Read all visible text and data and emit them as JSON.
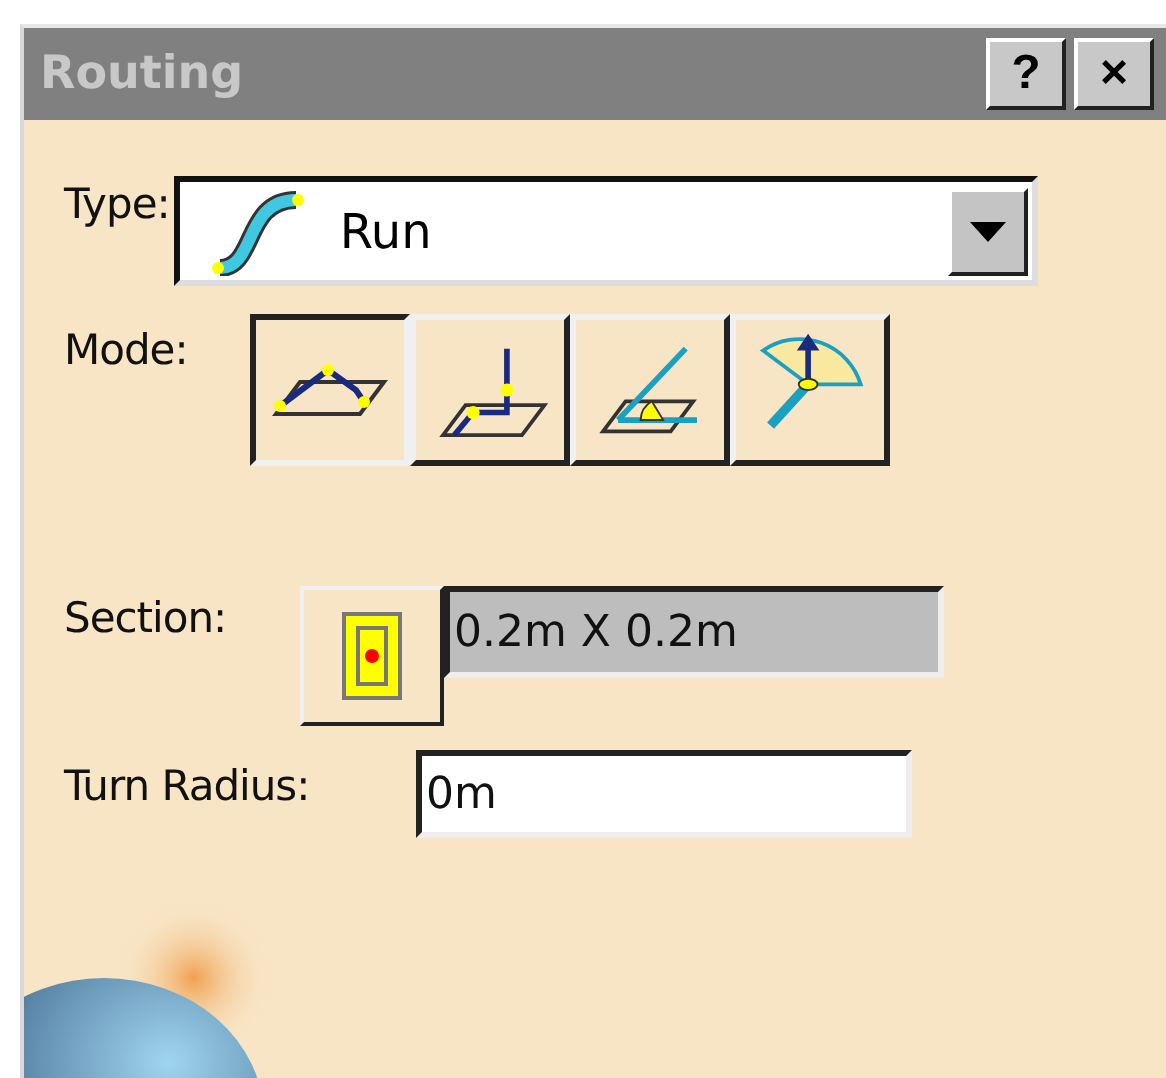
{
  "window": {
    "title": "Routing",
    "help_button": "?",
    "close_button": "×"
  },
  "type": {
    "label": "Type:",
    "value": "Run"
  },
  "mode": {
    "label": "Mode:",
    "options": [
      {
        "kind": "polyline",
        "selected": true
      },
      {
        "kind": "orthogonal",
        "selected": false
      },
      {
        "kind": "angle",
        "selected": false
      },
      {
        "kind": "branch",
        "selected": false
      }
    ]
  },
  "section": {
    "label": "Section:",
    "value": "0.2m X 0.2m"
  },
  "turn_radius": {
    "label": "Turn Radius:",
    "value": "0m"
  }
}
